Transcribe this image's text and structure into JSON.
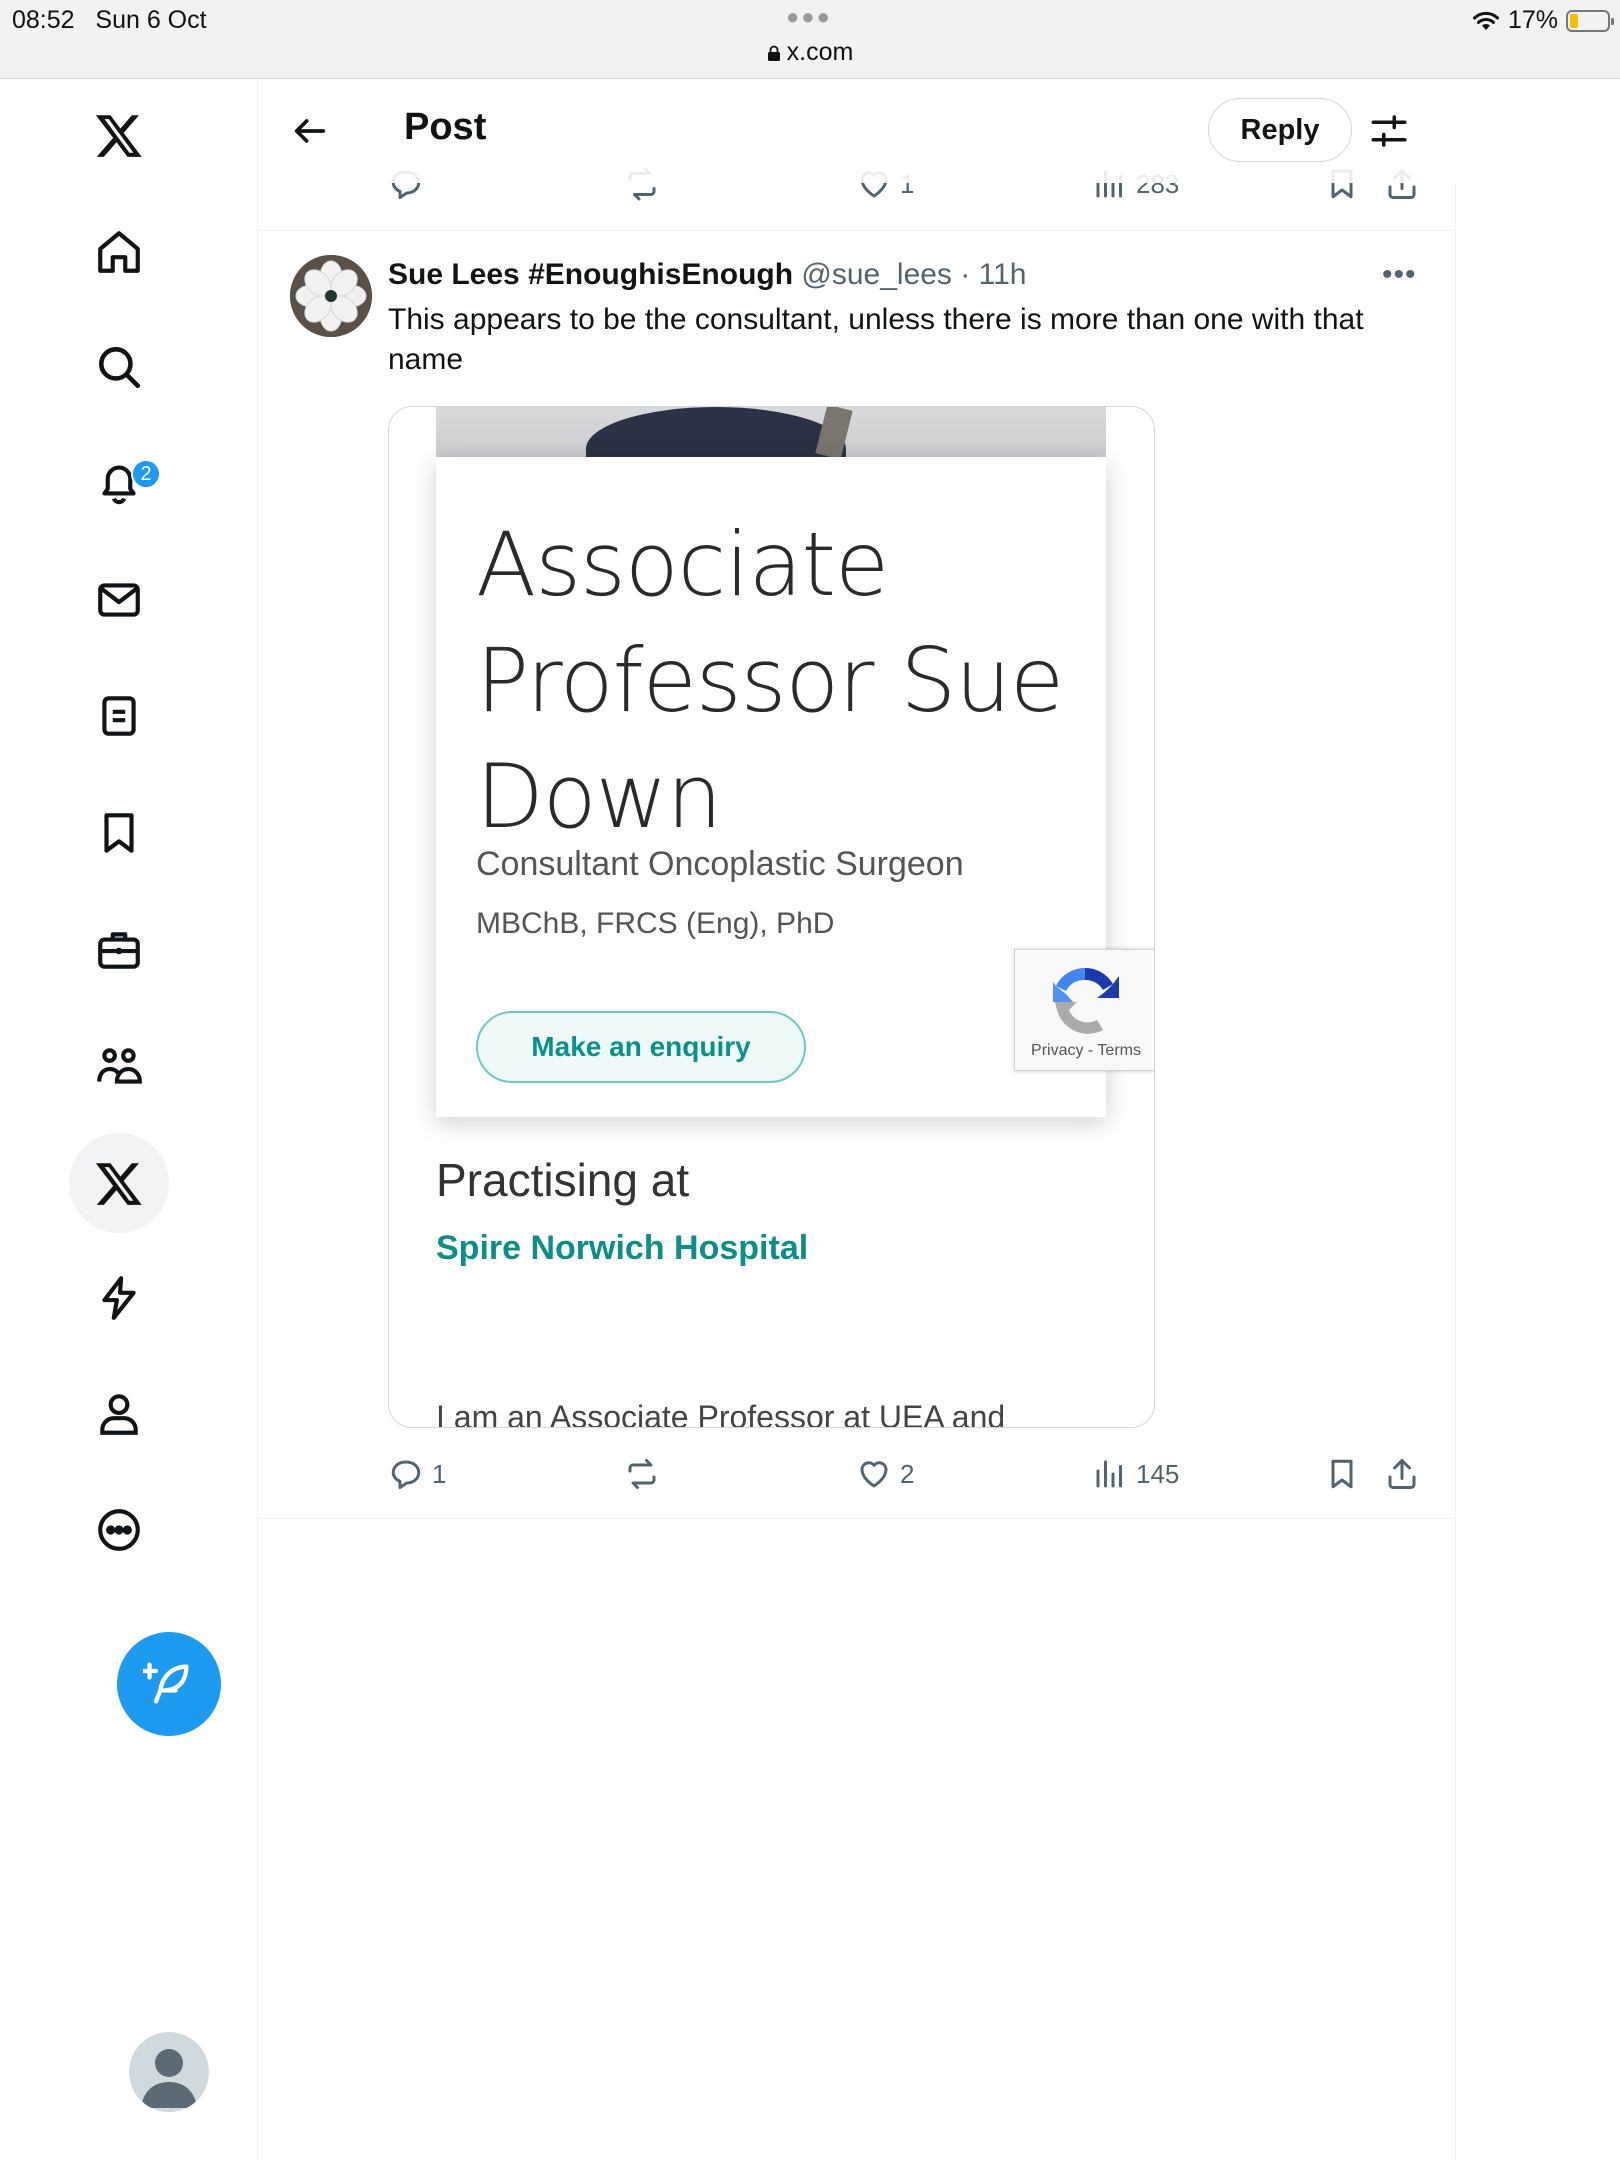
{
  "status_bar": {
    "time": "08:52",
    "date": "Sun 6 Oct",
    "url": "x.com",
    "battery": "17%"
  },
  "sidebar": {
    "notifications_badge": "2",
    "items": [
      "x-logo",
      "home",
      "explore",
      "notifications",
      "messages",
      "lists",
      "bookmarks",
      "jobs",
      "communities",
      "premium",
      "verified-orgs",
      "profile",
      "more"
    ]
  },
  "header": {
    "title": "Post",
    "reply_label": "Reply"
  },
  "previous_post_actions": {
    "likes": "1",
    "views": "283"
  },
  "post": {
    "author_name": "Sue Lees #EnoughisEnough",
    "handle": "@sue_lees",
    "time": "· 11h",
    "text": "This appears to be the consultant, unless there is more than one with that name",
    "replies": "1",
    "likes": "2",
    "views": "145"
  },
  "media": {
    "name": "Associate Professor Sue Down",
    "role": "Consultant Oncoplastic Surgeon",
    "qualifications": "MBChB, FRCS (Eng), PhD",
    "enquiry_button": "Make an enquiry",
    "recaptcha_links": "Privacy - Terms",
    "practising_label": "Practising at",
    "hospital": "Spire Norwich Hospital",
    "about_text": "I am an Associate Professor at UEA and"
  },
  "colors": {
    "accent": "#1d9bf0",
    "teal": "#0b8f86",
    "muted": "#536471"
  }
}
